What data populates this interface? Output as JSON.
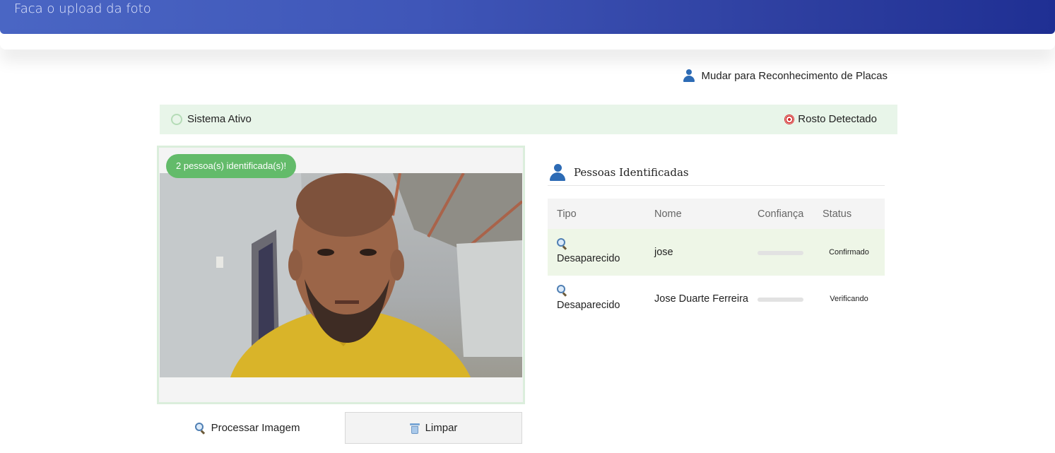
{
  "header": {
    "title": "Faca o upload da foto"
  },
  "switch_link": {
    "label": "Mudar para Reconhecimento de Placas",
    "icon": "person-icon"
  },
  "status_bar": {
    "system_status": "Sistema Ativo",
    "detection_status": "Rosto Detectado",
    "colors": {
      "background": "#e8f5e9"
    }
  },
  "image_panel": {
    "badge": "2 pessoa(s) identificada(s)!",
    "badge_color": "#63bb6a"
  },
  "buttons": {
    "process_label": "Processar Imagem",
    "clear_label": "Limpar"
  },
  "results": {
    "title": "Pessoas Identificadas",
    "columns": [
      "Tipo",
      "Nome",
      "Confiança",
      "Status"
    ],
    "rows": [
      {
        "tipo": "Desaparecido",
        "nome": "jose",
        "status": "Confirmado"
      },
      {
        "tipo": "Desaparecido",
        "nome": "Jose Duarte Ferreira",
        "status": "Verificando"
      }
    ]
  },
  "colors": {
    "header_gradient_start": "#4a66c4",
    "header_gradient_end": "#1f2f93",
    "confirmed_row": "#eef6e7"
  }
}
